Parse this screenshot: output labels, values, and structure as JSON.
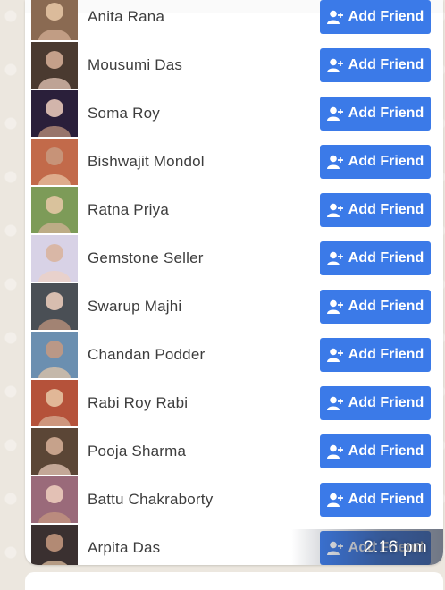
{
  "message": {
    "timestamp": "2:16 pm",
    "button_label": "Add Friend",
    "button_color": "#3b7ae8",
    "people": [
      {
        "name": "Anita Rana",
        "avatar_color": "#8a6a52"
      },
      {
        "name": "Mousumi Das",
        "avatar_color": "#4a3a30"
      },
      {
        "name": "Soma Roy",
        "avatar_color": "#2a1f3a"
      },
      {
        "name": "Bishwajit Mondol",
        "avatar_color": "#c26a4a"
      },
      {
        "name": "Ratna Priya",
        "avatar_color": "#7d9b58"
      },
      {
        "name": "Gemstone Seller",
        "avatar_color": "#d8d2e6"
      },
      {
        "name": "Swarup Majhi",
        "avatar_color": "#4a4f55"
      },
      {
        "name": "Chandan Podder",
        "avatar_color": "#6b8fb0"
      },
      {
        "name": "Rabi Roy Rabi",
        "avatar_color": "#b5523a"
      },
      {
        "name": "Pooja Sharma",
        "avatar_color": "#5b4636"
      },
      {
        "name": "Battu Chakraborty",
        "avatar_color": "#9a6a7a"
      },
      {
        "name": "Arpita Das",
        "avatar_color": "#3a3030"
      }
    ]
  }
}
